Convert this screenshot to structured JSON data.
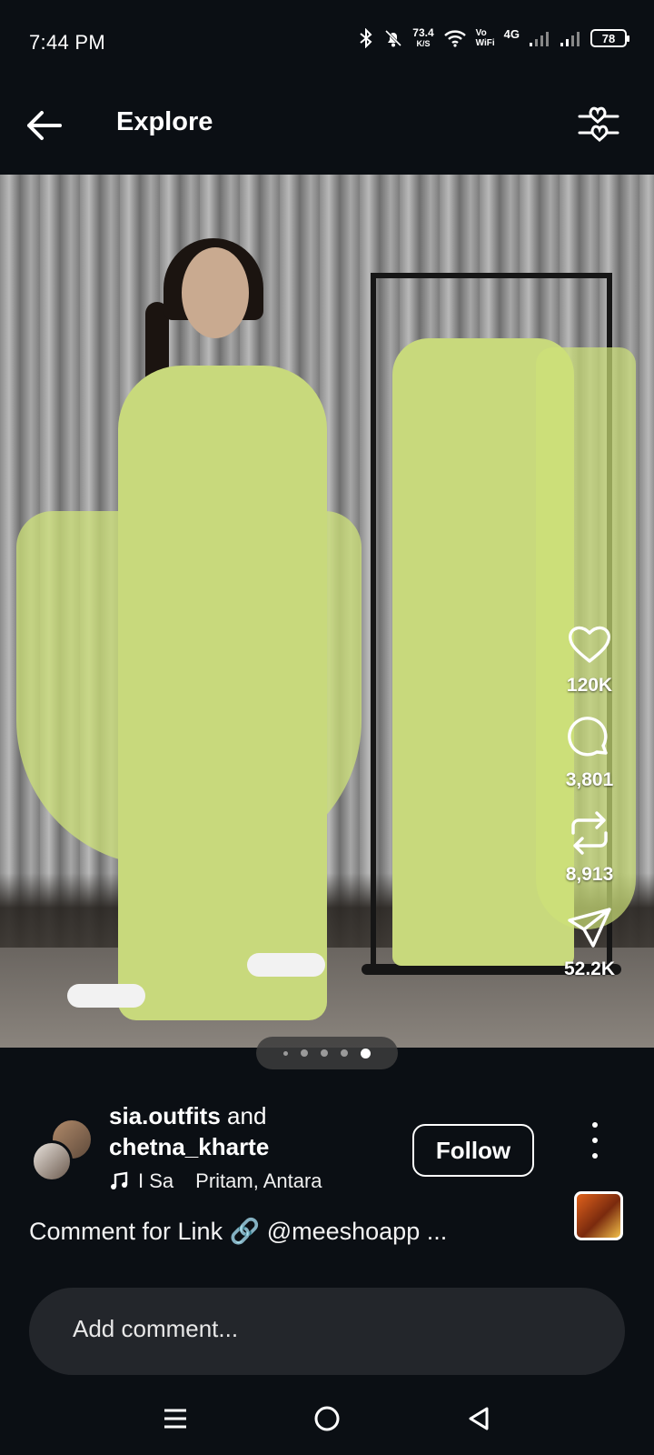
{
  "status_bar": {
    "time": "7:44 PM",
    "net_speed_value": "73.4",
    "net_speed_unit": "K/S",
    "vo": "Vo",
    "wifi": "WiFi",
    "network": "4G",
    "battery": "78"
  },
  "header": {
    "title": "Explore",
    "back_icon": "arrow-left-icon",
    "filter_icon": "heart-sliders-icon"
  },
  "media": {
    "carousel_total": 5,
    "carousel_active_index": 4
  },
  "actions": {
    "likes": "120K",
    "comments": "3,801",
    "reposts": "8,913",
    "shares": "52.2K"
  },
  "author": {
    "primary": "sia.outfits",
    "joiner": "and",
    "secondary": "chetna_kharte",
    "audio_title": "I Sa",
    "audio_artists": "Pritam, Antara",
    "follow_label": "Follow"
  },
  "caption": {
    "text": "Comment for Link 🔗 @meeshoapp ..."
  },
  "comment": {
    "placeholder": "Add comment..."
  },
  "colors": {
    "background": "#0b0f14",
    "comment_bg": "#23262b",
    "outfit": "#c8d97c"
  }
}
